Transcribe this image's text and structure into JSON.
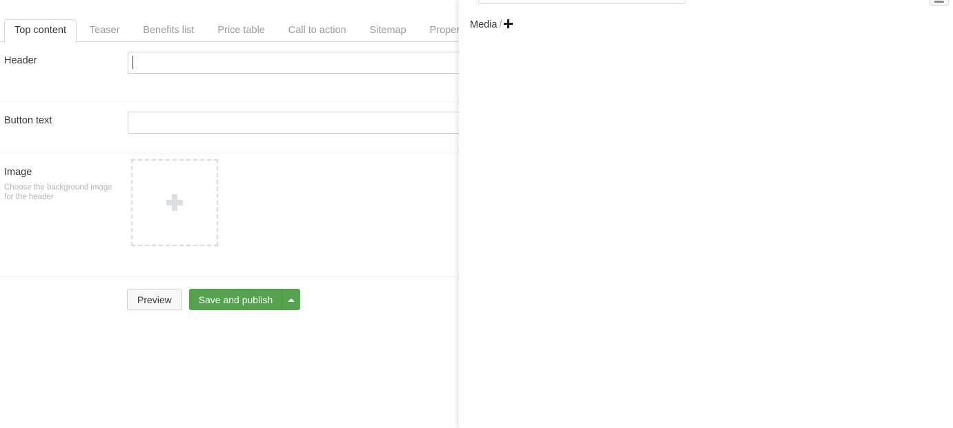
{
  "editor": {
    "tabs": [
      {
        "label": "Top content",
        "active": true
      },
      {
        "label": "Teaser",
        "active": false
      },
      {
        "label": "Benefits list",
        "active": false
      },
      {
        "label": "Price table",
        "active": false
      },
      {
        "label": "Call to action",
        "active": false
      },
      {
        "label": "Sitemap",
        "active": false
      },
      {
        "label": "Properties",
        "active": false
      }
    ],
    "fields": {
      "header": {
        "label": "Header",
        "value": "",
        "placeholder": "",
        "focused": true
      },
      "button_text": {
        "label": "Button text",
        "value": "",
        "placeholder": "",
        "focused": false
      },
      "image": {
        "label": "Image",
        "description": "Choose the background image for the header",
        "dropzone_icon": "plus-icon"
      }
    },
    "actions": {
      "preview_label": "Preview",
      "save_label": "Save and publish",
      "save_caret_icon": "caret-up-icon"
    }
  },
  "media_panel": {
    "search_value": "",
    "search_placeholder": "",
    "breadcrumb": {
      "root_label": "Media",
      "separator": "/",
      "add_icon": "plus-icon"
    },
    "corner_icon": "minimize-icon"
  },
  "colors": {
    "primary_green": "#54a14e",
    "text": "#373737",
    "muted_text": "#9a9a9a",
    "description_text": "#b5b5b5",
    "border": "#d8d7d9",
    "input_border": "#d0d0d0",
    "dashed_border": "#d9d9d9",
    "dropzone_plus": "#dadee3",
    "rule": "#f3f3f3",
    "panel_background": "#ffffff"
  }
}
